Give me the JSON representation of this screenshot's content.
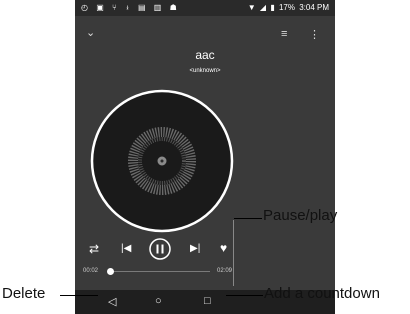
{
  "status_bar": {
    "left_icons": [
      "alarm-icon",
      "image-icon",
      "usb-icon",
      "download-icon",
      "clipboard-icon",
      "sim-icon",
      "bug-icon"
    ],
    "battery": "17%",
    "time": "3:04 PM"
  },
  "song": {
    "title": "aac",
    "artist": "<unknown>"
  },
  "progress": {
    "elapsed": "00:02",
    "total": "02:09",
    "fraction": 0.02
  },
  "callouts": {
    "pause_play": "Pause/play",
    "delete": "Delete",
    "countdown": "Add a countdown"
  },
  "colors": {
    "screen_bg": "#3a3a3a",
    "disc": "#191919",
    "ring": "#ffffff"
  }
}
